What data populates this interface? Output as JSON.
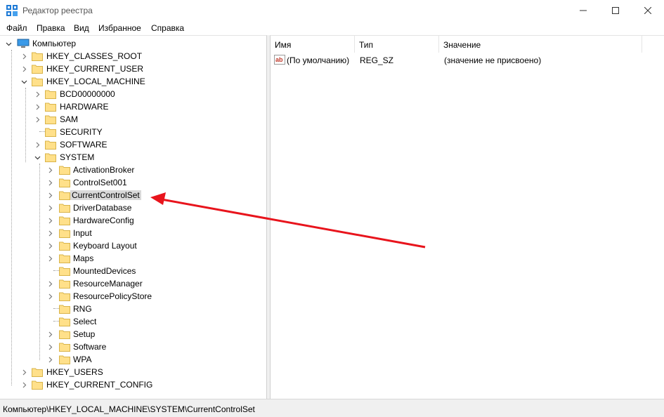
{
  "window": {
    "title": "Редактор реестра",
    "controls": {
      "minimize": "minimize-icon",
      "maximize": "maximize-icon",
      "close": "close-icon"
    }
  },
  "menu": [
    "Файл",
    "Правка",
    "Вид",
    "Избранное",
    "Справка"
  ],
  "tree": {
    "root": "Компьютер",
    "hkcr": "HKEY_CLASSES_ROOT",
    "hkcu": "HKEY_CURRENT_USER",
    "hklm": "HKEY_LOCAL_MACHINE",
    "hklm_children": [
      "BCD00000000",
      "HARDWARE",
      "SAM",
      "SECURITY",
      "SOFTWARE",
      "SYSTEM"
    ],
    "system_children": [
      "ActivationBroker",
      "ControlSet001",
      "CurrentControlSet",
      "DriverDatabase",
      "HardwareConfig",
      "Input",
      "Keyboard Layout",
      "Maps",
      "MountedDevices",
      "ResourceManager",
      "ResourcePolicyStore",
      "RNG",
      "Select",
      "Setup",
      "Software",
      "WPA"
    ],
    "hku": "HKEY_USERS",
    "hkcc": "HKEY_CURRENT_CONFIG",
    "selected": "CurrentControlSet"
  },
  "list": {
    "columns": {
      "name": "Имя",
      "type": "Тип",
      "value": "Значение"
    },
    "rows": [
      {
        "name": "(По умолчанию)",
        "type": "REG_SZ",
        "value": "(значение не присвоено)"
      }
    ]
  },
  "status": "Компьютер\\HKEY_LOCAL_MACHINE\\SYSTEM\\CurrentControlSet",
  "colors": {
    "annotation_arrow": "#e8141c",
    "folder_fill": "#ffe08a",
    "folder_edge": "#d9b44a",
    "selection": "#d9d9d9"
  }
}
